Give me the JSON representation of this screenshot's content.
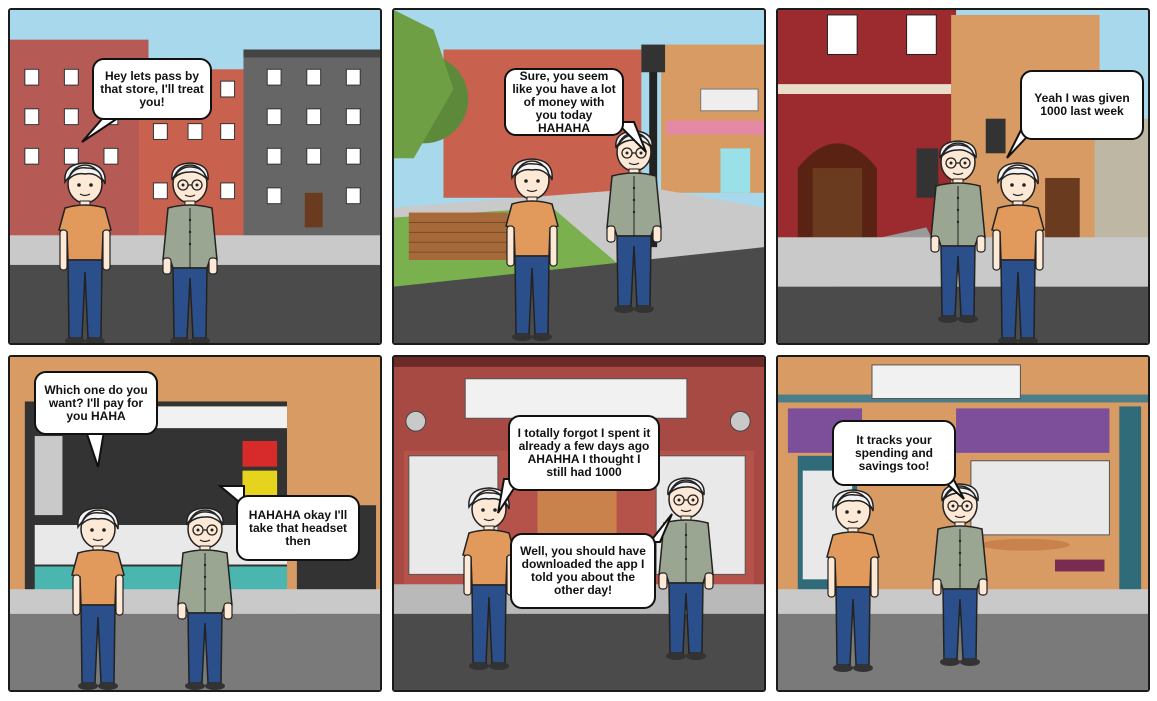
{
  "comic": {
    "panels": [
      {
        "id": 1,
        "setting": "city-street",
        "bubbles": [
          {
            "speaker": "boy",
            "text": "Hey lets pass by that store, I'll treat you!"
          }
        ]
      },
      {
        "id": 2,
        "setting": "park-sidewalk",
        "bubbles": [
          {
            "speaker": "friend",
            "text": "Sure, you seem like you have a lot of money with you today HAHAHA"
          }
        ]
      },
      {
        "id": 3,
        "setting": "brick-building",
        "bubbles": [
          {
            "speaker": "boy",
            "text": "Yeah I was given 1000 last week"
          }
        ]
      },
      {
        "id": 4,
        "setting": "store-shelves",
        "bubbles": [
          {
            "speaker": "boy",
            "text": "Which one do you want? I'll pay for you HAHA"
          },
          {
            "speaker": "friend",
            "text": "HAHAHA okay I'll take that headset then"
          }
        ]
      },
      {
        "id": 5,
        "setting": "storefront",
        "bubbles": [
          {
            "speaker": "boy",
            "text": "I totally forgot I spent it already a few days ago AHAHHA I thought I still had 1000"
          },
          {
            "speaker": "friend",
            "text": "Well, you should have downloaded the app I told you about the other day!"
          }
        ]
      },
      {
        "id": 6,
        "setting": "cafe",
        "bubbles": [
          {
            "speaker": "friend",
            "text": "It tracks your spending and savings too!"
          }
        ]
      }
    ]
  },
  "colors": {
    "sky": "#a7d8ec",
    "road": "#4b4b4b",
    "sidewalk": "#c9c9c9",
    "brick_red": "#b55a54",
    "boy_shirt": "#e19a5c",
    "friend_shirt": "#9aa592",
    "pants": "#2a4f8a",
    "border": "#1b1b1b"
  }
}
